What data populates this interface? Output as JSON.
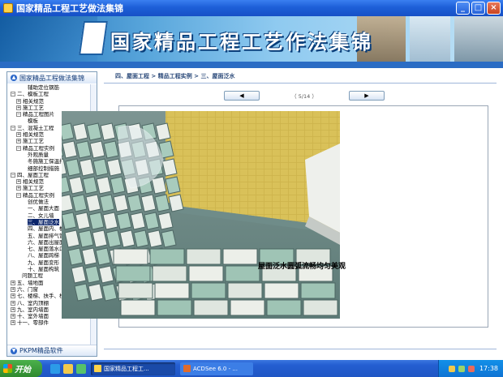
{
  "window": {
    "title": "国家精品工程工艺做法集锦",
    "controls": {
      "minimize": "_",
      "maximize": "□",
      "close": "×"
    }
  },
  "banner": {
    "title": "国家精品工程工艺作法集锦"
  },
  "sidebar": {
    "header": "国家精品工程做法集锦",
    "footer": "PKPM精品软件",
    "tree": [
      {
        "label": "辅助定位钢筋",
        "depth": 3,
        "toggle": ""
      },
      {
        "label": "二、模板工程",
        "depth": 0,
        "toggle": "−"
      },
      {
        "label": "相关规范",
        "depth": 1,
        "toggle": "+"
      },
      {
        "label": "施工工艺",
        "depth": 1,
        "toggle": "+"
      },
      {
        "label": "精品工程图片",
        "depth": 1,
        "toggle": "−"
      },
      {
        "label": "模板",
        "depth": 3,
        "toggle": ""
      },
      {
        "label": "三、混凝土工程",
        "depth": 0,
        "toggle": "−"
      },
      {
        "label": "相关规范",
        "depth": 1,
        "toggle": "+"
      },
      {
        "label": "施工工艺",
        "depth": 1,
        "toggle": "+"
      },
      {
        "label": "精品工程实例",
        "depth": 1,
        "toggle": "−"
      },
      {
        "label": "外观质量",
        "depth": 3,
        "toggle": ""
      },
      {
        "label": "冬施施工保温措施",
        "depth": 3,
        "toggle": ""
      },
      {
        "label": "细部控制措施",
        "depth": 3,
        "toggle": ""
      },
      {
        "label": "四、屋面工程",
        "depth": 0,
        "toggle": "−"
      },
      {
        "label": "相关规范",
        "depth": 1,
        "toggle": "+"
      },
      {
        "label": "施工工艺",
        "depth": 1,
        "toggle": "+"
      },
      {
        "label": "精品工程实例",
        "depth": 1,
        "toggle": "−"
      },
      {
        "label": "创优做法",
        "depth": 3,
        "toggle": ""
      },
      {
        "label": "一、屋面大面",
        "depth": 3,
        "toggle": ""
      },
      {
        "label": "二、女儿墙",
        "depth": 3,
        "toggle": ""
      },
      {
        "label": "三、屋面泛水",
        "depth": 3,
        "toggle": "",
        "selected": true
      },
      {
        "label": "四、屋面内、檐",
        "depth": 3,
        "toggle": ""
      },
      {
        "label": "五、屋面排气管、",
        "depth": 3,
        "toggle": ""
      },
      {
        "label": "六、屋面出屋面",
        "depth": 3,
        "toggle": ""
      },
      {
        "label": "七、屋面落水口",
        "depth": 3,
        "toggle": ""
      },
      {
        "label": "八、屋面跨梯",
        "depth": 3,
        "toggle": ""
      },
      {
        "label": "九、屋面变形",
        "depth": 3,
        "toggle": ""
      },
      {
        "label": "十、屋面构筑",
        "depth": 3,
        "toggle": ""
      },
      {
        "label": "问题工程",
        "depth": 2,
        "toggle": ""
      },
      {
        "label": "五、墙地面",
        "depth": 0,
        "toggle": "+"
      },
      {
        "label": "六、门窗",
        "depth": 0,
        "toggle": "+"
      },
      {
        "label": "七、楼梯、扶手、栏杆",
        "depth": 0,
        "toggle": "+"
      },
      {
        "label": "八、室内顶棚",
        "depth": 0,
        "toggle": "+"
      },
      {
        "label": "九、室内墙面",
        "depth": 0,
        "toggle": "+"
      },
      {
        "label": "十、室外墙面",
        "depth": 0,
        "toggle": "+"
      },
      {
        "label": "十一、零部件",
        "depth": 0,
        "toggle": "+"
      }
    ]
  },
  "content": {
    "breadcrumb": "四、屋面工程 > 精品工程实例 > 三、屋面泛水",
    "prev_label": "◀",
    "next_label": "▶",
    "page_indicator": "（ 5/14 ）",
    "caption": "屋面泛水圆弧流畅均匀美观"
  },
  "taskbar": {
    "start_label": "开始",
    "tasks": [
      {
        "label": "国家精品工程工...",
        "active": true
      },
      {
        "label": "ACDSee 6.0 - ...",
        "active": false
      }
    ],
    "clock": "17:38"
  },
  "colors": {
    "title_bar": "#1d5fd8",
    "banner": "#5aa7dc",
    "selection": "#0a246a",
    "taskbar": "#245ed1"
  }
}
